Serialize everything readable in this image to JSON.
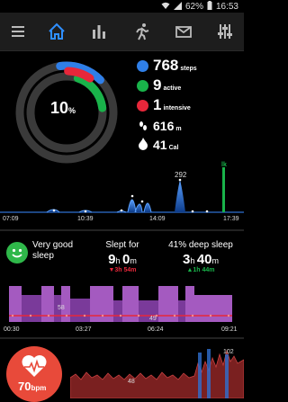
{
  "status": {
    "battery": "62%",
    "time": "16:53"
  },
  "toolbar": {
    "items": [
      {
        "name": "menu"
      },
      {
        "name": "home",
        "active": true
      },
      {
        "name": "stats"
      },
      {
        "name": "running"
      },
      {
        "name": "mail"
      },
      {
        "name": "settings"
      }
    ]
  },
  "summary": {
    "percent": "10",
    "percent_unit": "%",
    "steps": {
      "value": "768",
      "unit": "steps",
      "color": "#2f7fe8"
    },
    "active": {
      "value": "9",
      "unit": "active",
      "color": "#19b34a"
    },
    "intensive": {
      "value": "1",
      "unit": "intensive",
      "color": "#e7273a"
    },
    "distance": {
      "value": "616",
      "unit": "m"
    },
    "calories": {
      "value": "41",
      "unit": "Cal"
    },
    "ring_progress": {
      "steps": 0.15,
      "active": 0.18,
      "intensive": 0.09
    }
  },
  "activity_chart": {
    "x_ticks": [
      "07:09",
      "10:39",
      "14:09",
      "17:39"
    ],
    "peak_label": "292",
    "goal_label": "lk"
  },
  "sleep": {
    "quality_label": "Very good sleep",
    "slept_for_label": "Slept for",
    "slept_h": "9",
    "slept_m": "0",
    "slept_delta": "3h 54m",
    "deep_label": "41% deep sleep",
    "deep_h": "3",
    "deep_m": "40",
    "deep_delta": "1h 44m",
    "chart_marker_58": "58",
    "chart_marker_49": "49",
    "x_ticks": [
      "00:30",
      "03:27",
      "06:24",
      "09:21"
    ]
  },
  "heart": {
    "bpm_value": "70",
    "bpm_unit": "bpm",
    "label_48": "48",
    "label_102": "102"
  }
}
